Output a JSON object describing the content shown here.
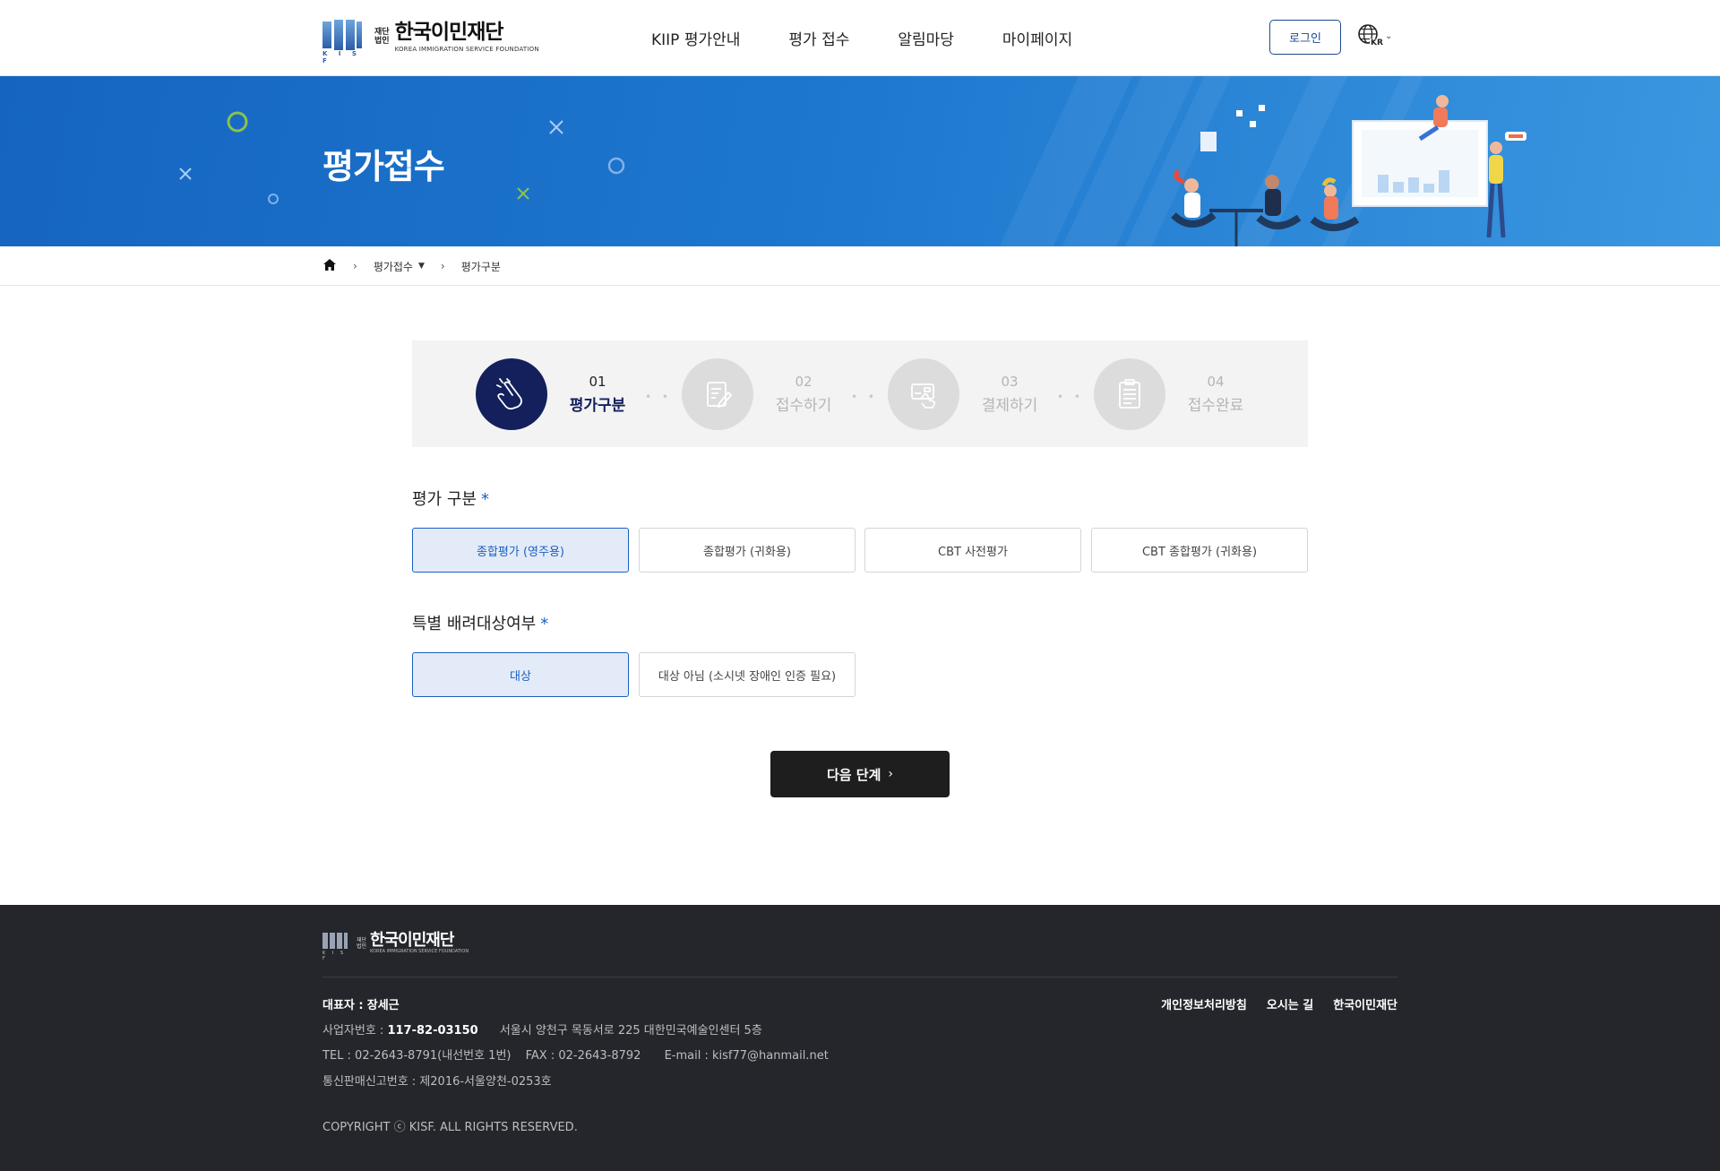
{
  "header": {
    "logo_sub": [
      "재단",
      "법인"
    ],
    "logo_title": "한국이민재단",
    "logo_en": "KOREA IMMIGRATION SERVICE FOUNDATION",
    "logo_mark_text": "K I S F",
    "nav": [
      "KIIP 평가안내",
      "평가 접수",
      "알림마당",
      "마이페이지"
    ],
    "login_label": "로그인",
    "lang_code": "KR"
  },
  "banner": {
    "title": "평가접수"
  },
  "breadcrumb": {
    "current_section": "평가접수",
    "current_page": "평가구분"
  },
  "steps": [
    {
      "num": "01",
      "label": "평가구분",
      "icon": "hand-pointer-icon",
      "active": true
    },
    {
      "num": "02",
      "label": "접수하기",
      "icon": "document-edit-icon",
      "active": false
    },
    {
      "num": "03",
      "label": "결제하기",
      "icon": "card-payment-icon",
      "active": false
    },
    {
      "num": "04",
      "label": "접수완료",
      "icon": "clipboard-icon",
      "active": false
    }
  ],
  "form": {
    "eval_type_title": "평가 구분",
    "eval_type_required": "*",
    "eval_type_options": [
      "종합평가 (영주용)",
      "종합평가 (귀화용)",
      "CBT 사전평가",
      "CBT 종합평가 (귀화용)"
    ],
    "eval_type_selected": 0,
    "special_title": "특별 배려대상여부",
    "special_required": "*",
    "special_options": [
      "대상",
      "대상 아님 (소시넷 장애인 인증 필요)"
    ],
    "special_selected": 0,
    "next_label": "다음 단계"
  },
  "footer": {
    "logo_title": "한국이민재단",
    "logo_sub": [
      "재단",
      "법인"
    ],
    "logo_en": "KOREA IMMIGRATION SERVICE FOUNDATION",
    "logo_mark_text": "K I S F",
    "ceo_label": "대표자 :",
    "ceo_name": "장세근",
    "biz_label": "사업자번호 :",
    "biz_number": "117-82-03150",
    "address": "서울시 양천구 목동서로 225 대한민국예술인센터 5층",
    "tel": "TEL : 02-2643-8791(내선번호 1번)",
    "fax": "FAX : 02-2643-8792",
    "email": "E-mail : kisf77@hanmail.net",
    "mail_order": "통신판매신고번호 : 제2016-서울양천-0253호",
    "copyright": "COPYRIGHT ⓒ KISF. ALL RIGHTS RESERVED.",
    "links": [
      "개인정보처리방침",
      "오시는 길",
      "한국이민재단"
    ]
  },
  "colors": {
    "primary": "#1b5fc1",
    "step_active": "#13205c",
    "banner": "#1e78cf",
    "footer_bg": "#25262b",
    "selected_bg": "#e3ebf8"
  }
}
